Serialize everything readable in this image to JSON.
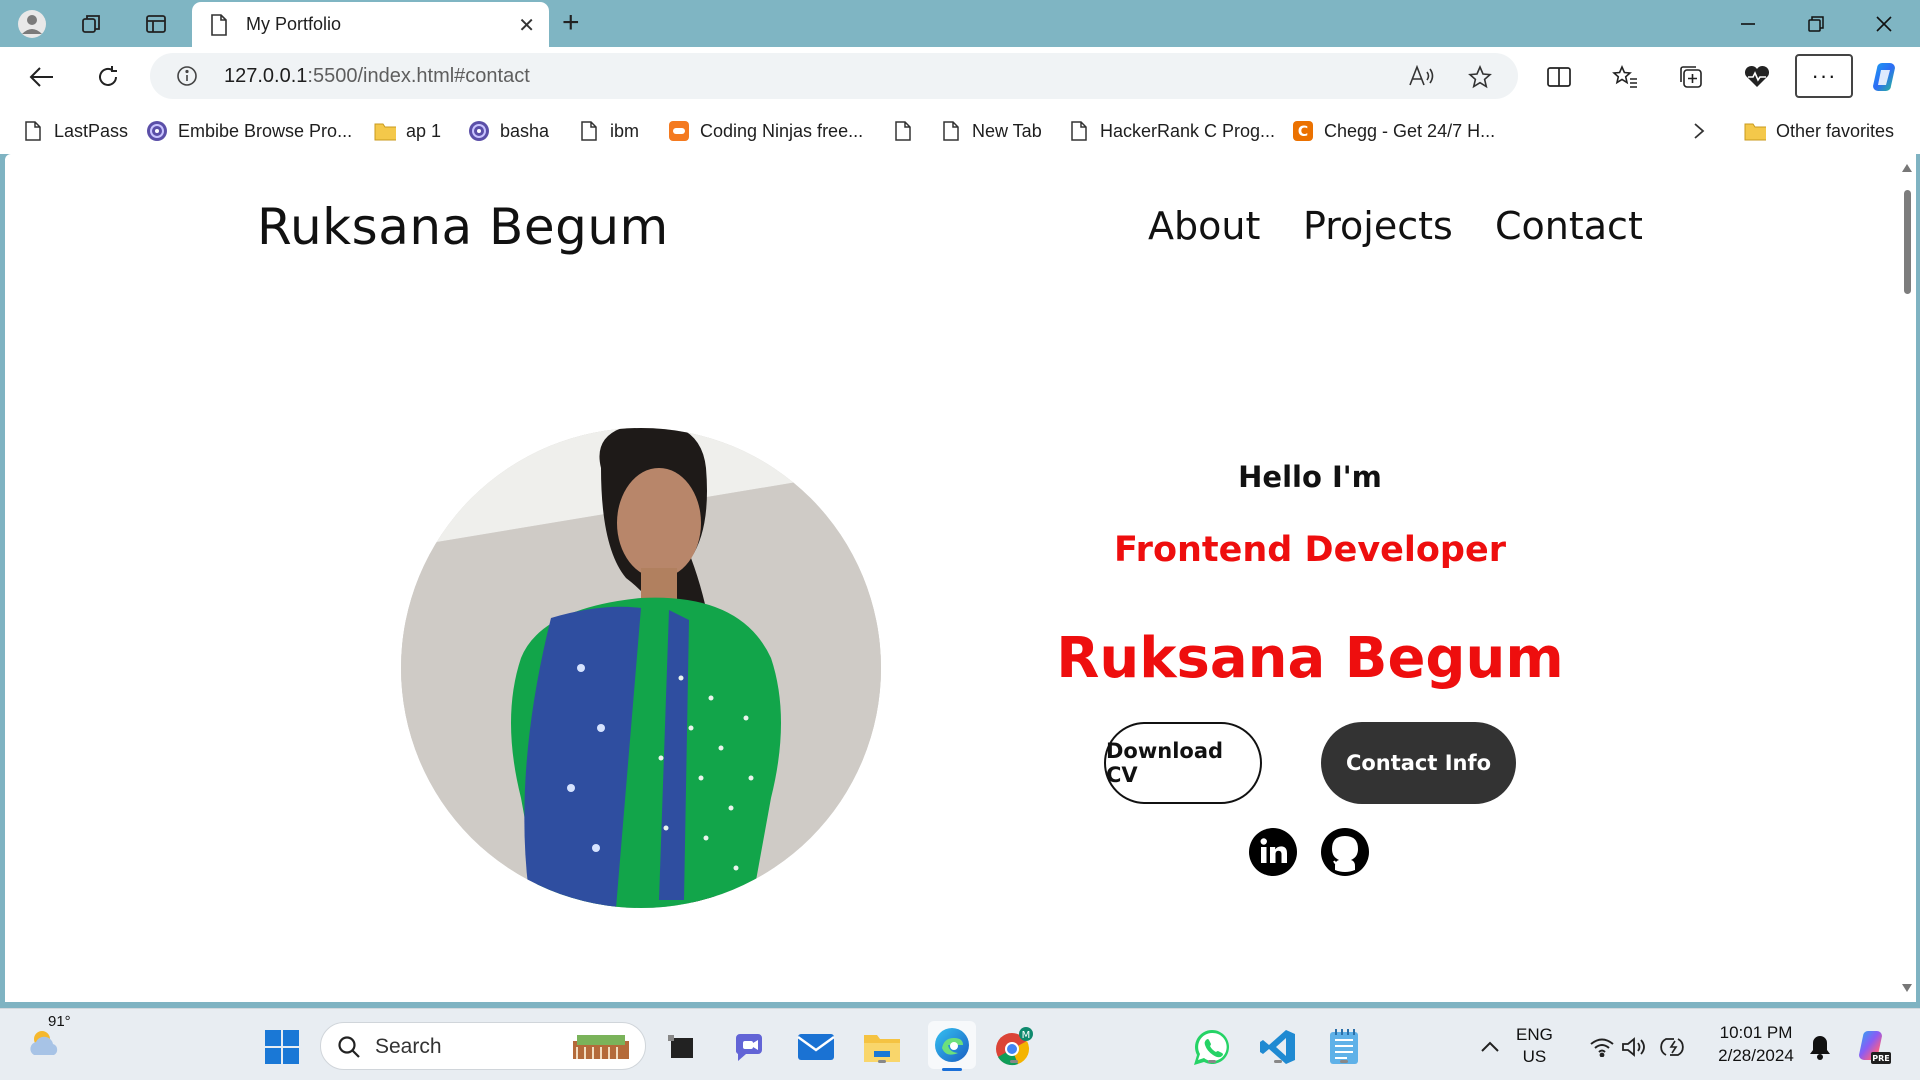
{
  "browser": {
    "tab_title": "My Portfolio",
    "url_host": "127.0.0.1",
    "url_rest": ":5500/index.html#contact",
    "bookmarks": [
      {
        "label": "LastPass",
        "icon": "page-icon"
      },
      {
        "label": "Embibe Browse Pro...",
        "icon": "embibe-icon"
      },
      {
        "label": "ap 1",
        "icon": "folder-icon"
      },
      {
        "label": "basha",
        "icon": "embibe-icon"
      },
      {
        "label": "ibm",
        "icon": "page-icon"
      },
      {
        "label": "Coding Ninjas free...",
        "icon": "coding-ninjas-icon"
      },
      {
        "label": "",
        "icon": "page-icon"
      },
      {
        "label": "New Tab",
        "icon": "page-icon"
      },
      {
        "label": "HackerRank C Prog...",
        "icon": "page-icon"
      },
      {
        "label": "Chegg - Get 24/7 H...",
        "icon": "chegg-icon"
      }
    ],
    "other_favorites": "Other favorites"
  },
  "site": {
    "logo": "Ruksana Begum",
    "nav": [
      "About",
      "Projects",
      "Contact"
    ],
    "hero": {
      "greeting": "Hello I'm",
      "role": "Frontend Developer",
      "name": "Ruksana Begum",
      "download_cv": "Download CV",
      "contact_info": "Contact Info"
    }
  },
  "taskbar": {
    "weather_temp": "91°",
    "search_placeholder": "Search",
    "lang_line1": "ENG",
    "lang_line2": "US",
    "time": "10:01 PM",
    "date": "2/28/2024"
  },
  "colors": {
    "accent_red": "#ee0e0e",
    "button_dark": "#333333",
    "titlebar": "#7fb5c3"
  }
}
